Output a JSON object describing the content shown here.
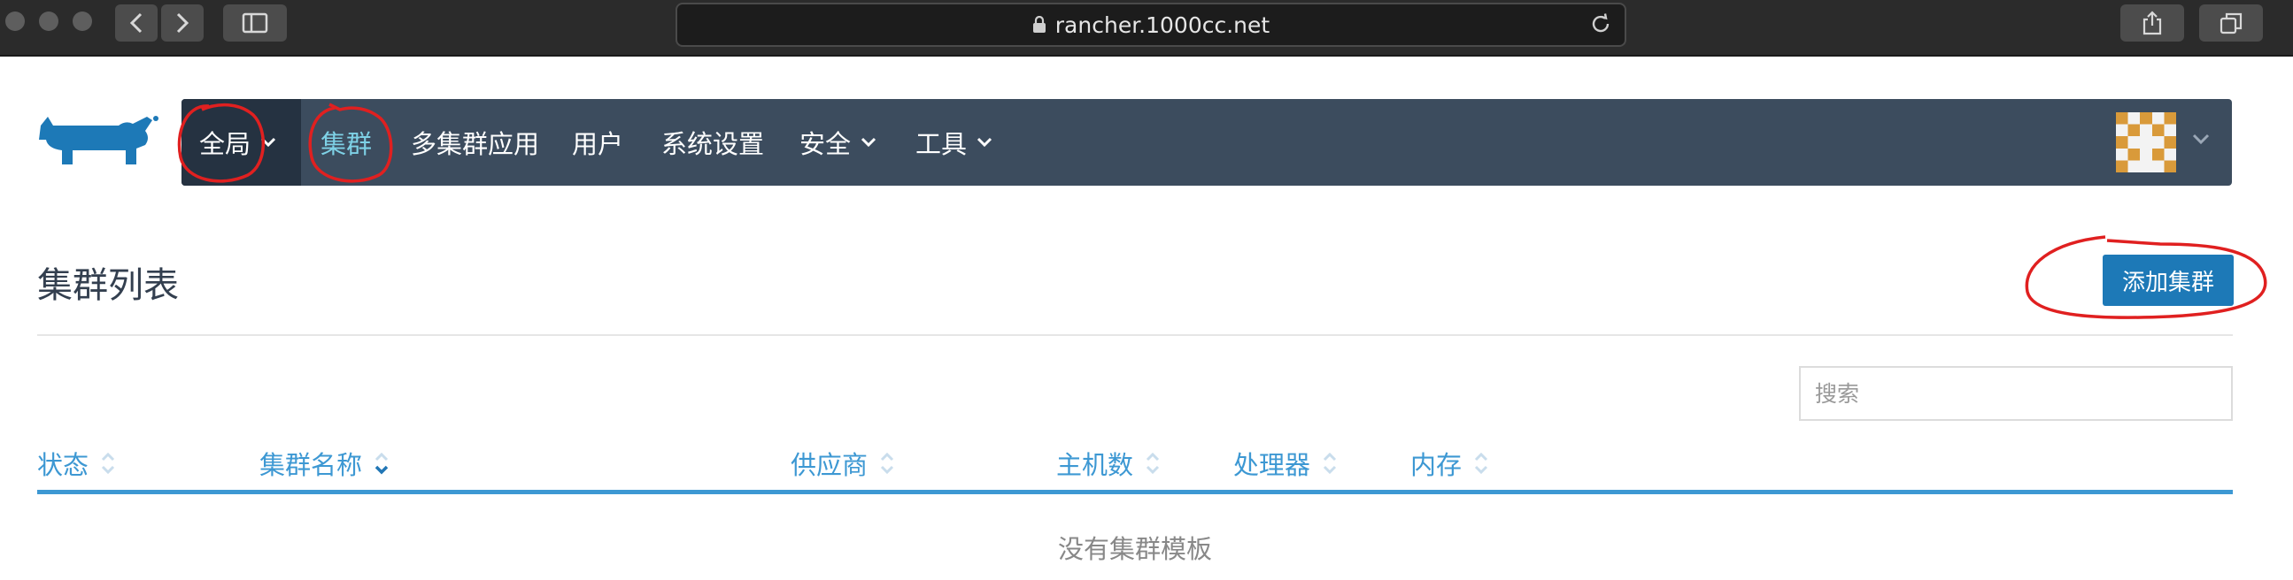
{
  "browser": {
    "url": "rancher.1000cc.net"
  },
  "nav": {
    "global_label": "全局",
    "items": [
      {
        "label": "集群",
        "active": true
      },
      {
        "label": "多集群应用"
      },
      {
        "label": "用户"
      },
      {
        "label": "系统设置"
      },
      {
        "label": "安全"
      },
      {
        "label": "工具"
      }
    ]
  },
  "page": {
    "title": "集群列表",
    "add_button_label": "添加集群",
    "search_placeholder": "搜索"
  },
  "table": {
    "columns": [
      "状态",
      "集群名称",
      "供应商",
      "主机数",
      "处理器",
      "内存"
    ],
    "empty_text": "没有集群模板"
  },
  "colors": {
    "navbar": "#3c4c5e",
    "navbar_global": "#253241",
    "accent": "#1d79b7",
    "link": "#3d98d3",
    "active_nav": "#7ed1e6",
    "annotation": "#e02020"
  },
  "icons": {
    "logo": "rancher-cow-logo",
    "avatar": "identicon-avatar"
  }
}
